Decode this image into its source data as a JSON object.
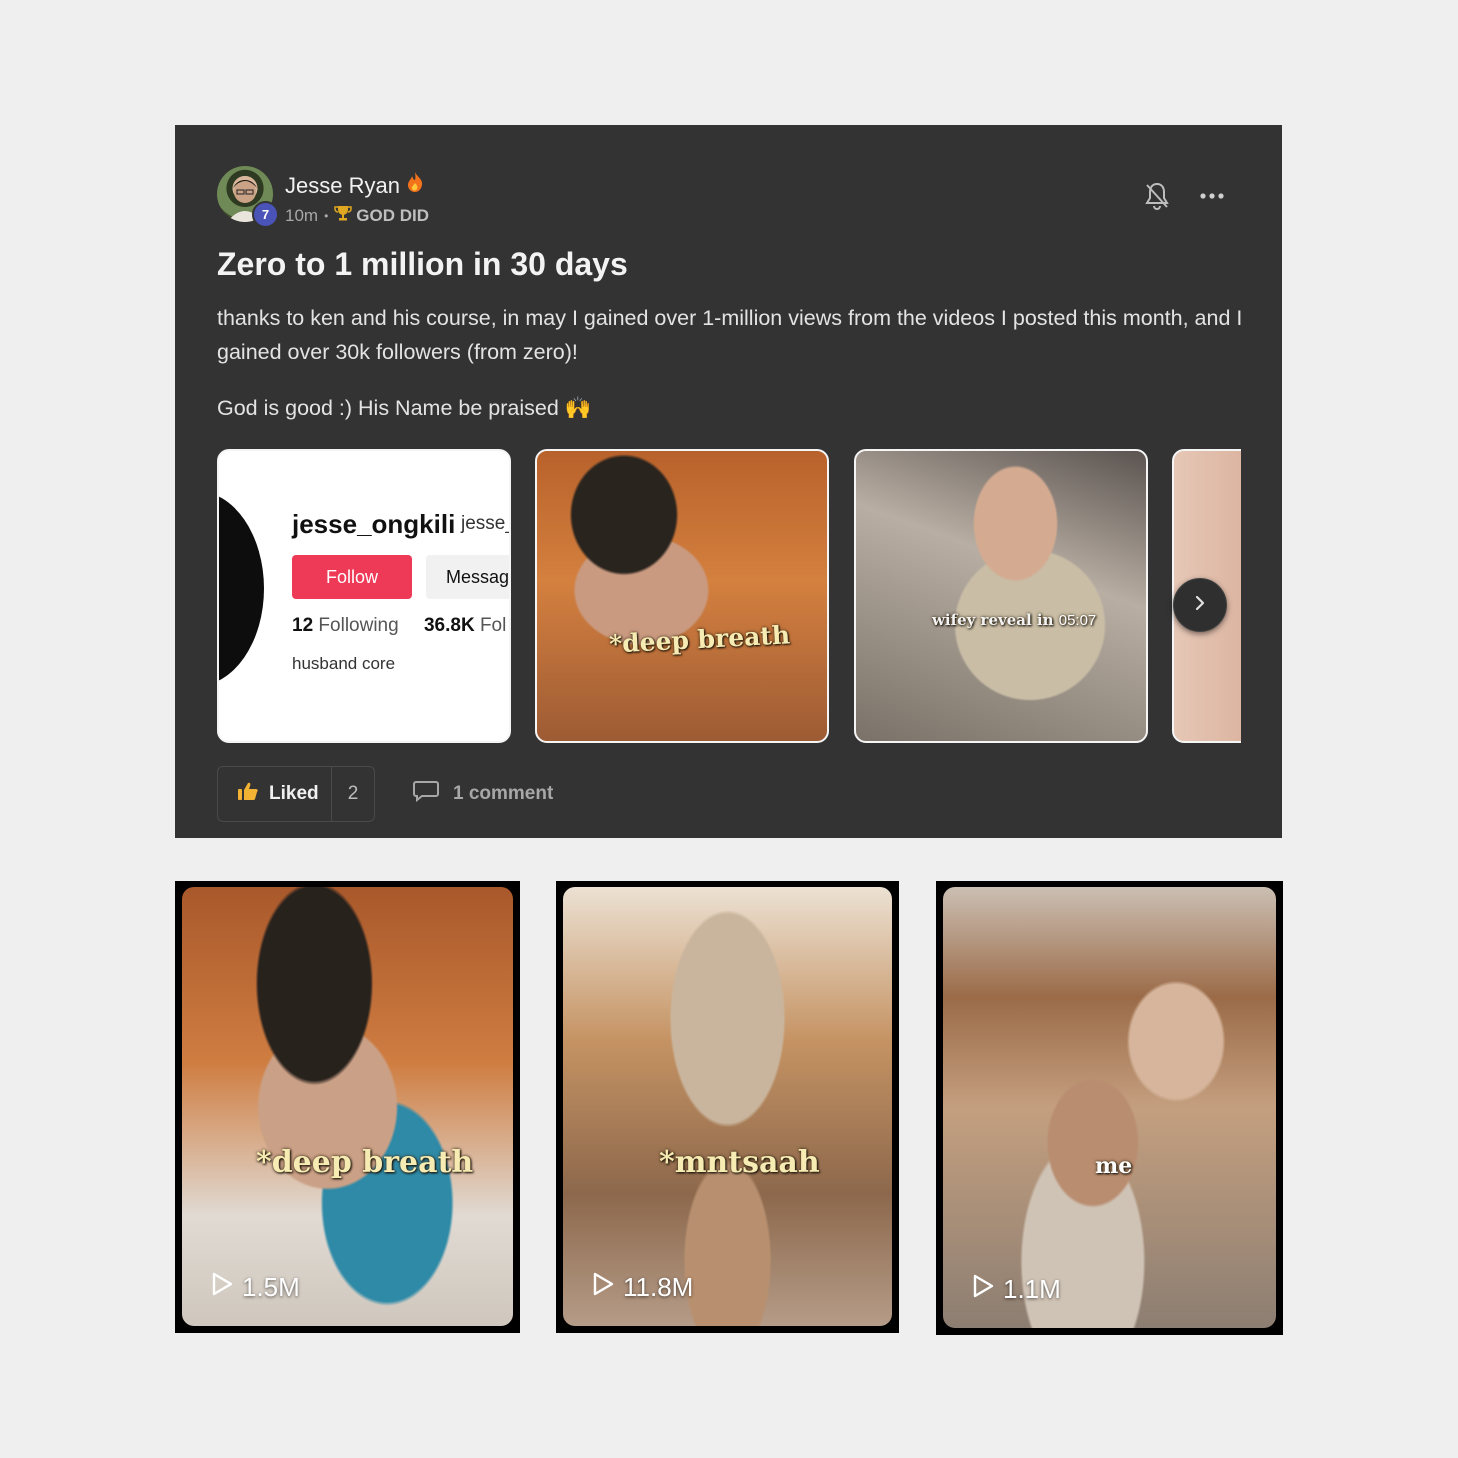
{
  "post": {
    "author": "Jesse Ryan",
    "level": "7",
    "time": "10m",
    "group": "GOD DID",
    "title": "Zero to 1 million in 30 days",
    "paragraph1": "thanks to ken and his course, in may I gained over 1-million views from the videos I posted this month, and I gained over 30k followers (from zero)!",
    "paragraph2": "God is good :) His Name be praised 🙌",
    "profile_card": {
      "username": "jesse_ongkili",
      "username2": "jesse_",
      "follow": "Follow",
      "message": "Messag",
      "following_count": "12",
      "following_label": "Following",
      "followers_count": "36.8K",
      "followers_label": "Fol",
      "bio": "husband core"
    },
    "slide2_caption": "*deep breath",
    "slide3_caption": "wifey reveal in",
    "slide3_time": "05:07",
    "liked_label": "Liked",
    "like_count": "2",
    "comment_label": "1 comment"
  },
  "videos": [
    {
      "caption": "*deep breath",
      "views": "1.5M"
    },
    {
      "caption": "*mntsaah",
      "views": "11.8M"
    },
    {
      "caption": "me",
      "views": "1.1M"
    }
  ],
  "colors": {
    "card_bg": "#333333",
    "page_bg": "#efefef",
    "follow_red": "#ee3a57",
    "level_badge": "#4a53b8"
  },
  "icons": {
    "bell": "bell-off-icon",
    "more": "more-horizontal-icon",
    "trophy": "trophy-icon",
    "fire": "fire-icon",
    "thumb": "thumbs-up-icon",
    "comment": "comment-icon",
    "play": "play-icon",
    "next": "chevron-right-icon"
  }
}
